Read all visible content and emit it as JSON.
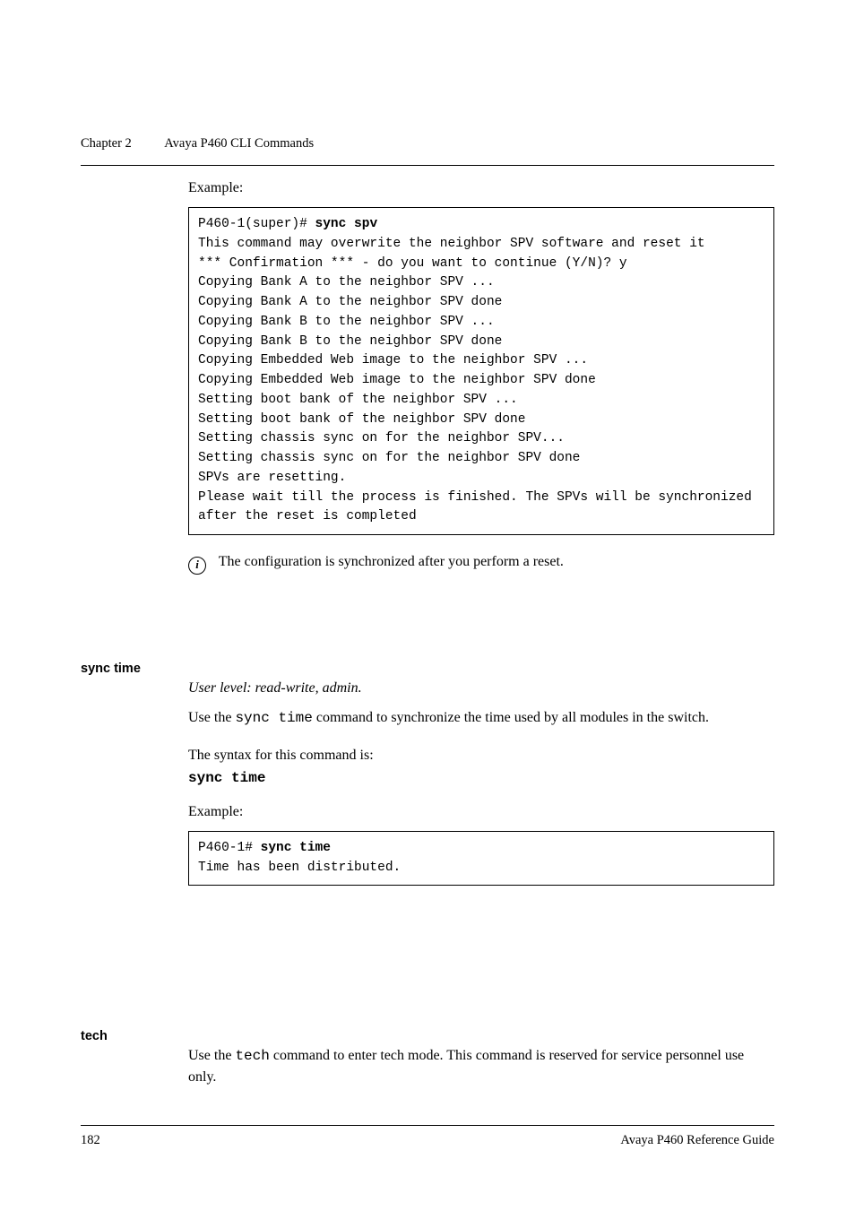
{
  "header": {
    "chapter_label": "Chapter 2",
    "chapter_title": "Avaya P460 CLI Commands"
  },
  "sync_spv": {
    "example_label": "Example:",
    "prompt": "P460-1(super)# ",
    "command": "sync spv",
    "output": "This command may overwrite the neighbor SPV software and reset it\n*** Confirmation *** - do you want to continue (Y/N)? y\nCopying Bank A to the neighbor SPV ...\nCopying Bank A to the neighbor SPV done\nCopying Bank B to the neighbor SPV ...\nCopying Bank B to the neighbor SPV done\nCopying Embedded Web image to the neighbor SPV ...\nCopying Embedded Web image to the neighbor SPV done\nSetting boot bank of the neighbor SPV ...\nSetting boot bank of the neighbor SPV done\nSetting chassis sync on for the neighbor SPV...\nSetting chassis sync on for the neighbor SPV done\nSPVs are resetting.\nPlease wait till the process is finished. The SPVs will be synchronized after the reset is completed",
    "note_icon": "i",
    "note_text": "The configuration is synchronized after you perform a reset."
  },
  "sync_time": {
    "heading": "sync time",
    "user_level": "User level: read-write, admin.",
    "desc_pre": "Use the ",
    "desc_cmd": "sync time",
    "desc_post": " command to synchronize the time used by all modules in the switch.",
    "syntax_label": "The syntax for this command is:",
    "syntax_cmd": "sync time",
    "example_label": "Example:",
    "prompt": "P460-1# ",
    "command": "sync time",
    "output": "Time has been distributed."
  },
  "tech": {
    "heading": "tech",
    "desc_pre": "Use the ",
    "desc_cmd": "tech",
    "desc_post": " command to enter tech mode. This command is reserved for service personnel use only."
  },
  "footer": {
    "page_number": "182",
    "doc_title": "Avaya P460 Reference Guide"
  }
}
